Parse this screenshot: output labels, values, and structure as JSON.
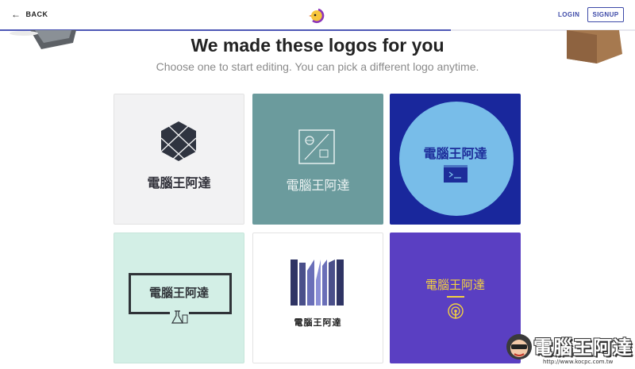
{
  "nav": {
    "back_label": "BACK",
    "login_label": "LOGIN",
    "signup_label": "SIGNUP",
    "progress_fraction": 0.71
  },
  "header": {
    "title": "We made these logos for you",
    "subtitle": "Choose one to start editing. You can pick a different logo anytime."
  },
  "logos": [
    {
      "text": "電腦王阿達",
      "icon": "hexagon-lines-icon",
      "bg": "#f2f2f3"
    },
    {
      "text": "電腦王阿達",
      "icon": "square-globe-icon",
      "bg": "#6b9b9d"
    },
    {
      "text": "電腦王阿達",
      "icon": "terminal-icon",
      "bg": "#19279c"
    },
    {
      "text": "電腦王阿達",
      "icon": "flask-icon",
      "bg": "#d3efe6"
    },
    {
      "text": "電腦王阿達",
      "icon": "m-bars-icon",
      "bg": "#ffffff"
    },
    {
      "text": "電腦王阿達",
      "icon": "podcast-icon",
      "bg": "#5a3fc2"
    }
  ],
  "watermark": {
    "text": "電腦王阿達",
    "url": "http://www.kocpc.com.tw"
  },
  "colors": {
    "accent": "#3d4aa8"
  }
}
